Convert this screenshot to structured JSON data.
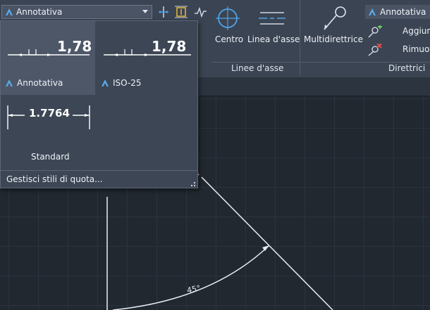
{
  "dim_style_combo": {
    "value": "Annotativa"
  },
  "dropdown": {
    "styles": [
      {
        "name": "Annotativa",
        "preview_value": "1,78",
        "selected": true
      },
      {
        "name": "ISO-25",
        "preview_value": "1,78",
        "selected": false
      },
      {
        "name": "Standard",
        "preview_value": "1.7764",
        "selected": false
      }
    ],
    "manage_label": "Gestisci stili di quota..."
  },
  "centerlines_panel": {
    "center_label": "Centro",
    "centerline_label": "Linea d'asse",
    "title": "Linee d'asse"
  },
  "leaders_panel": {
    "multileader_label": "Multidirettrice",
    "style_value": "Annotativa",
    "add_label": "Aggiun",
    "remove_label": "Rimuov",
    "title": "Direttrici"
  },
  "drawing": {
    "angle_label": "45°"
  },
  "colors": {
    "ribbon": "#3b4453",
    "canvas": "#212830",
    "accent": "#4fa3e6"
  }
}
